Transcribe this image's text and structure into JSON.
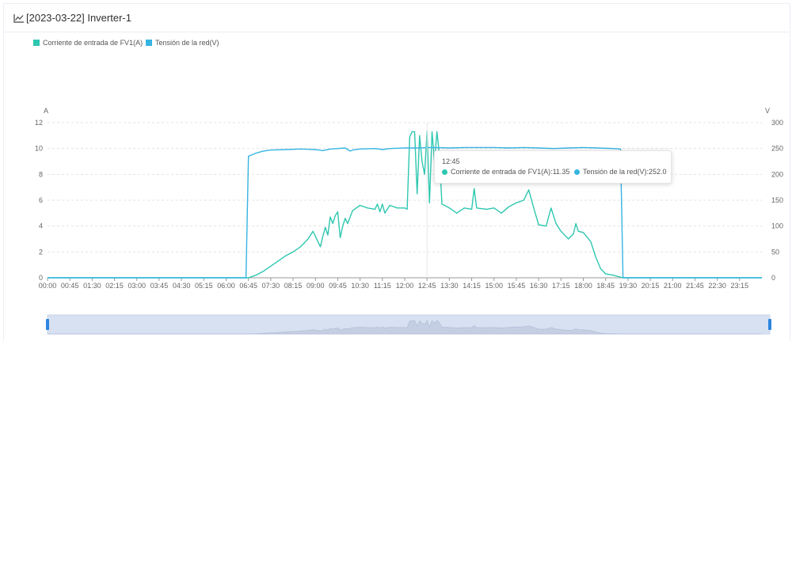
{
  "header": {
    "title": "[2023-03-22] Inverter-1",
    "icon": "line-chart-icon"
  },
  "colors": {
    "series1": "#2ec7b0",
    "series2": "#36b4e2",
    "grid": "#e3e3e3",
    "axis": "#666666",
    "slider_fill": "#d7e1f1",
    "slider_handle": "#2f85e0"
  },
  "tooltip": {
    "time": "12:45",
    "items": [
      {
        "label": "Corriente de entrada de FV1(A):11.35",
        "color": "#2ec7b0"
      },
      {
        "label": "Tensión de la red(V):252.0",
        "color": "#36b4e2"
      }
    ]
  },
  "chart_data": {
    "type": "line",
    "title": "",
    "legend": [
      "Corriente de entrada de FV1(A)",
      "Tensión de la red(V)"
    ],
    "legend_position": "top-left",
    "x_ticks": [
      "00:00",
      "00:45",
      "01:30",
      "02:15",
      "03:00",
      "03:45",
      "04:30",
      "05:15",
      "06:00",
      "06:45",
      "07:30",
      "08:15",
      "09:00",
      "09:45",
      "10:30",
      "11:15",
      "12:00",
      "12:45",
      "13:30",
      "14:15",
      "15:00",
      "15:45",
      "16:30",
      "17:15",
      "18:00",
      "18:45",
      "19:30",
      "20:15",
      "21:00",
      "21:45",
      "22:30",
      "23:15"
    ],
    "x_range_hours": [
      0,
      24
    ],
    "y_left": {
      "label": "A",
      "min": 0,
      "max": 12,
      "ticks": [
        0,
        2,
        4,
        6,
        8,
        10,
        12
      ]
    },
    "y_right": {
      "label": "V",
      "min": 0,
      "max": 300,
      "ticks": [
        0,
        50,
        100,
        150,
        200,
        250,
        300
      ]
    },
    "grid": true,
    "series": [
      {
        "name": "Corriente de entrada de FV1(A)",
        "axis": "left",
        "points": [
          [
            "00:00",
            0
          ],
          [
            "06:45",
            0
          ],
          [
            "07:00",
            0.2
          ],
          [
            "07:15",
            0.5
          ],
          [
            "07:30",
            0.9
          ],
          [
            "07:45",
            1.3
          ],
          [
            "08:00",
            1.7
          ],
          [
            "08:15",
            2.0
          ],
          [
            "08:30",
            2.4
          ],
          [
            "08:45",
            3.0
          ],
          [
            "08:55",
            3.6
          ],
          [
            "09:00",
            3.2
          ],
          [
            "09:10",
            2.4
          ],
          [
            "09:15",
            3.2
          ],
          [
            "09:20",
            3.9
          ],
          [
            "09:25",
            3.3
          ],
          [
            "09:30",
            4.7
          ],
          [
            "09:35",
            4.2
          ],
          [
            "09:40",
            4.8
          ],
          [
            "09:45",
            5.1
          ],
          [
            "09:50",
            3.1
          ],
          [
            "09:55",
            4.0
          ],
          [
            "10:00",
            4.6
          ],
          [
            "10:05",
            4.2
          ],
          [
            "10:15",
            5.2
          ],
          [
            "10:30",
            5.6
          ],
          [
            "10:45",
            5.4
          ],
          [
            "11:00",
            5.3
          ],
          [
            "11:05",
            5.7
          ],
          [
            "11:10",
            5.1
          ],
          [
            "11:15",
            5.7
          ],
          [
            "11:20",
            5.0
          ],
          [
            "11:30",
            5.6
          ],
          [
            "11:45",
            5.4
          ],
          [
            "12:00",
            5.4
          ],
          [
            "12:05",
            5.3
          ],
          [
            "12:10",
            10.9
          ],
          [
            "12:15",
            11.3
          ],
          [
            "12:20",
            11.3
          ],
          [
            "12:25",
            6.5
          ],
          [
            "12:30",
            11.0
          ],
          [
            "12:35",
            9.0
          ],
          [
            "12:40",
            8.0
          ],
          [
            "12:45",
            11.35
          ],
          [
            "12:50",
            5.8
          ],
          [
            "12:55",
            11.3
          ],
          [
            "13:00",
            9.0
          ],
          [
            "13:05",
            11.3
          ],
          [
            "13:10",
            9.5
          ],
          [
            "13:15",
            5.7
          ],
          [
            "13:30",
            5.4
          ],
          [
            "13:45",
            5.0
          ],
          [
            "14:00",
            5.4
          ],
          [
            "14:15",
            5.3
          ],
          [
            "14:20",
            6.9
          ],
          [
            "14:25",
            5.4
          ],
          [
            "14:45",
            5.3
          ],
          [
            "15:00",
            5.4
          ],
          [
            "15:15",
            5.0
          ],
          [
            "15:30",
            5.5
          ],
          [
            "15:45",
            5.8
          ],
          [
            "16:00",
            6.0
          ],
          [
            "16:10",
            6.8
          ],
          [
            "16:20",
            5.4
          ],
          [
            "16:30",
            4.1
          ],
          [
            "16:45",
            4.0
          ],
          [
            "16:55",
            5.4
          ],
          [
            "17:05",
            4.2
          ],
          [
            "17:15",
            3.6
          ],
          [
            "17:30",
            3.0
          ],
          [
            "17:40",
            3.4
          ],
          [
            "17:45",
            4.2
          ],
          [
            "17:50",
            3.6
          ],
          [
            "18:00",
            3.5
          ],
          [
            "18:15",
            2.8
          ],
          [
            "18:25",
            1.6
          ],
          [
            "18:35",
            0.7
          ],
          [
            "18:45",
            0.3
          ],
          [
            "19:00",
            0.2
          ],
          [
            "19:20",
            0
          ],
          [
            "24:00",
            0
          ]
        ]
      },
      {
        "name": "Tensión de la red(V)",
        "axis": "right",
        "points": [
          [
            "00:00",
            0
          ],
          [
            "06:40",
            0
          ],
          [
            "06:45",
            235
          ],
          [
            "07:00",
            241
          ],
          [
            "07:15",
            245
          ],
          [
            "07:30",
            247
          ],
          [
            "08:00",
            248
          ],
          [
            "08:30",
            249
          ],
          [
            "09:00",
            248
          ],
          [
            "09:15",
            246
          ],
          [
            "09:30",
            249
          ],
          [
            "09:45",
            250
          ],
          [
            "10:00",
            251
          ],
          [
            "10:10",
            245
          ],
          [
            "10:15",
            247
          ],
          [
            "10:30",
            249
          ],
          [
            "11:00",
            250
          ],
          [
            "11:15",
            248
          ],
          [
            "11:30",
            250
          ],
          [
            "12:00",
            251
          ],
          [
            "12:30",
            251
          ],
          [
            "12:45",
            252
          ],
          [
            "13:00",
            252
          ],
          [
            "13:30",
            251
          ],
          [
            "14:00",
            252
          ],
          [
            "14:30",
            252
          ],
          [
            "15:00",
            252
          ],
          [
            "15:30",
            251
          ],
          [
            "16:00",
            252
          ],
          [
            "16:30",
            251
          ],
          [
            "17:00",
            250
          ],
          [
            "17:30",
            251
          ],
          [
            "18:00",
            252
          ],
          [
            "18:30",
            251
          ],
          [
            "19:00",
            250
          ],
          [
            "19:15",
            249
          ],
          [
            "19:20",
            0
          ],
          [
            "24:00",
            0
          ]
        ]
      }
    ],
    "data_zoom": {
      "start_percent": 0,
      "end_percent": 100
    }
  }
}
